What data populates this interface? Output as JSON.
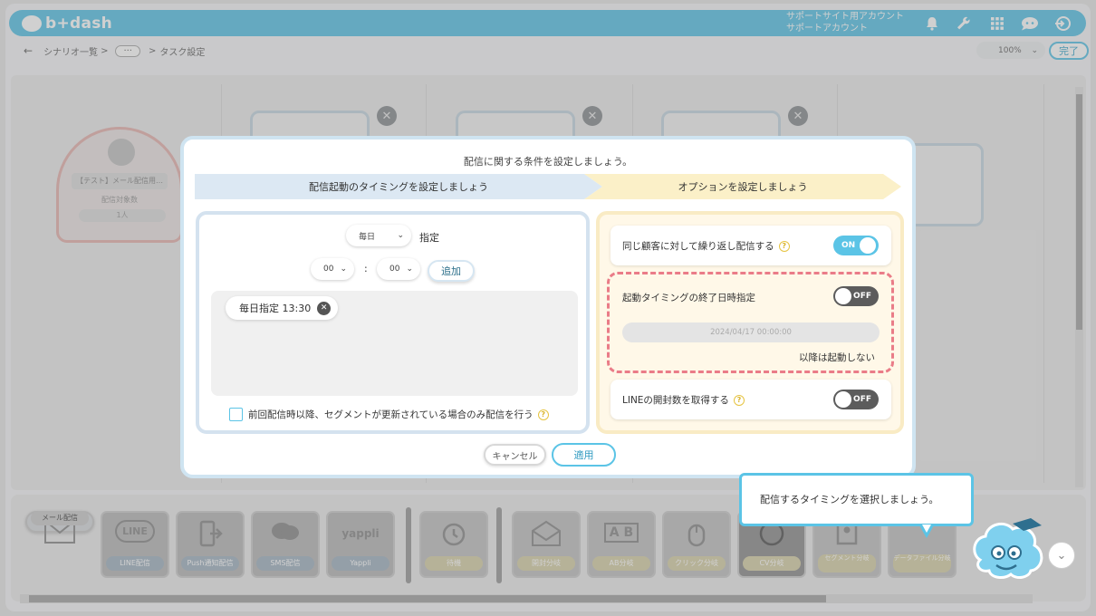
{
  "header": {
    "logo": "b+dash",
    "account_line1": "サポートサイト用アカウント",
    "account_line2": "サポートアカウント",
    "icons": [
      "bell-icon",
      "wrench-icon",
      "grid-icon",
      "chat-icon",
      "logout-icon"
    ]
  },
  "breadcrumb": {
    "back": "←",
    "item1": "シナリオ一覧",
    "sep": ">",
    "dots": "···",
    "item2": "タスク設定"
  },
  "zoom": {
    "value": "100%"
  },
  "done_label": "完了",
  "start_node": {
    "title": "【テスト】メール配信用…",
    "target_label": "配信対象数",
    "count": "1人"
  },
  "modal": {
    "title": "配信に関する条件を設定しましょう。",
    "step1": "配信起動のタイミングを設定しましょう",
    "step2": "オプションを設定しましょう",
    "frequency": "毎日",
    "frequency_suffix": "指定",
    "hour": "00",
    "minute": "00",
    "colon": ":",
    "add_label": "追加",
    "chip_label": "毎日指定 13:30",
    "segment_check_label": "前回配信時以降、セグメントが更新されている場合のみ配信を行う",
    "repeat_label": "同じ顧客に対して繰り返し配信する",
    "repeat_toggle": "ON",
    "end_label": "起動タイミングの終了日時指定",
    "end_toggle": "OFF",
    "end_date": "2024/04/17 00:00:00",
    "end_note": "以降は起動しない",
    "line_label": "LINEの開封数を取得する",
    "line_toggle": "OFF",
    "cancel_label": "キャンセル",
    "apply_label": "適用",
    "help": "?"
  },
  "tooltip": "配信するタイミングを選択しましょう。",
  "palette": [
    {
      "label": "メール配信",
      "icon": "envelope-icon"
    },
    {
      "label": "LINE配信",
      "icon": "line-icon"
    },
    {
      "label": "Push通知配信",
      "icon": "push-icon"
    },
    {
      "label": "SMS配信",
      "icon": "sms-icon"
    },
    {
      "label": "Yappli",
      "icon": "yappli-icon"
    },
    {
      "label": "待機",
      "icon": "alarm-icon"
    },
    {
      "label": "開封分岐",
      "icon": "open-mail-icon"
    },
    {
      "label": "AB分岐",
      "icon": "ab-icon"
    },
    {
      "label": "クリック分岐",
      "icon": "mouse-icon"
    },
    {
      "label": "CV分岐",
      "icon": "cv-icon"
    },
    {
      "label": "セグメント分岐",
      "icon": "segment-icon"
    },
    {
      "label": "データファイル分岐",
      "icon": "datafile-icon"
    }
  ],
  "palette_icon_text": {
    "line": "LINE",
    "yappli": "yappli",
    "ab": "A B"
  }
}
